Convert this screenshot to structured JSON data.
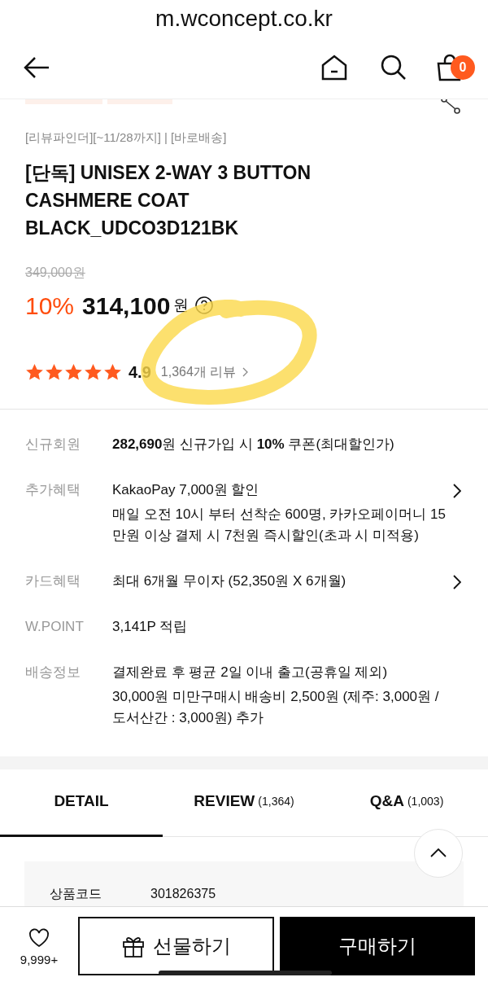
{
  "browser": {
    "url": "m.wconcept.co.kr"
  },
  "header": {
    "cart_count": "0"
  },
  "subtitle": "[리뷰파인더][~11/28까지] | [바로배송]",
  "title_lines": [
    "[단독] UNISEX 2-WAY 3 BUTTON",
    "CASHMERE COAT",
    "BLACK_UDCO3D121BK"
  ],
  "price": {
    "original": "349,000원",
    "discount": "10%",
    "amount": "314,100",
    "currency": "원"
  },
  "rating": {
    "stars": 5,
    "score": "4.9",
    "review_link": "1,364개 리뷰"
  },
  "benefits": [
    {
      "label": "신규회원",
      "lines": [
        "**282,690**원 신규가입 시 **10%** 쿠폰(최대할인가)"
      ],
      "chevron": false
    },
    {
      "label": "추가혜택",
      "lines": [
        "KakaoPay 7,000원 할인",
        "매일 오전 10시 부터 선착순 600명, 카카오페이머니 15 만원 이상 결제 시 7천원 즉시할인(초과 시 미적용)"
      ],
      "chevron": true
    },
    {
      "label": "카드혜택",
      "lines": [
        "최대 6개월 무이자 (52,350원 X 6개월)"
      ],
      "chevron": true
    },
    {
      "label": "W.POINT",
      "lines": [
        "3,141P 적립"
      ],
      "chevron": false
    },
    {
      "label": "배송정보",
      "lines": [
        "결제완료 후 평균 2일 이내 출고(공휴일 제외)",
        "30,000원 미만구매시 배송비 2,500원 (제주: 3,000원 / 도서산간 : 3,000원) 추가"
      ],
      "chevron": false
    }
  ],
  "tabs": [
    {
      "label": "DETAIL",
      "selected": true
    },
    {
      "label": "REVIEW",
      "count": "(1,364)",
      "selected": false
    },
    {
      "label": "Q&A",
      "count": "(1,003)",
      "selected": false
    }
  ],
  "detail": {
    "label": "상품코드",
    "value": "301826375"
  },
  "bottom_bar": {
    "like_count": "9,999+",
    "gift": "선물하기",
    "buy": "구매하기"
  }
}
